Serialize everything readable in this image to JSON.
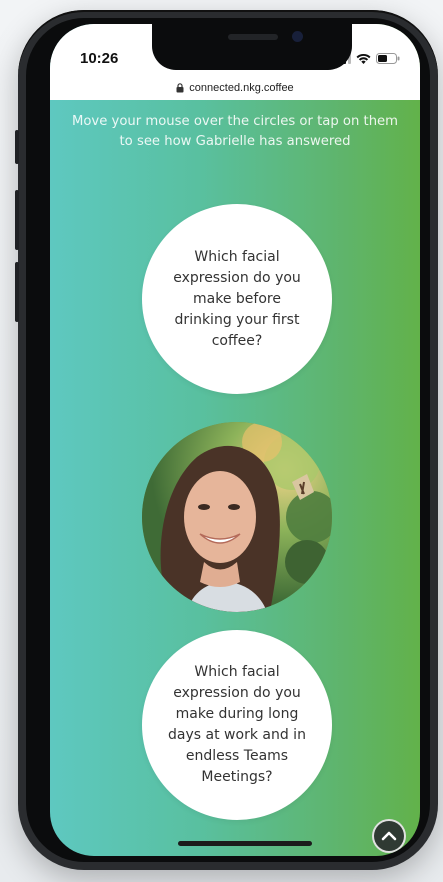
{
  "status_bar": {
    "time": "10:26"
  },
  "browser": {
    "url": "connected.nkg.coffee"
  },
  "page": {
    "intro_text": "Move your mouse over the circles or tap on them to see how Gabrielle has answered",
    "questions": [
      {
        "text": "Which facial expression do you make before drinking your first coffee?"
      },
      {
        "text": "Which facial expression do you make during long days at work and in endless Teams Meetings?"
      }
    ]
  },
  "icons": {
    "lock": "lock-icon",
    "signal": "cellular-signal-icon",
    "wifi": "wifi-icon",
    "battery": "battery-icon",
    "scroll_top": "chevron-up-icon"
  },
  "colors": {
    "gradient_left": "#5ec8c0",
    "gradient_right": "#62b24a",
    "circle_fill": "#ffffff",
    "question_text": "#333333",
    "intro_text": "#ffffff"
  }
}
